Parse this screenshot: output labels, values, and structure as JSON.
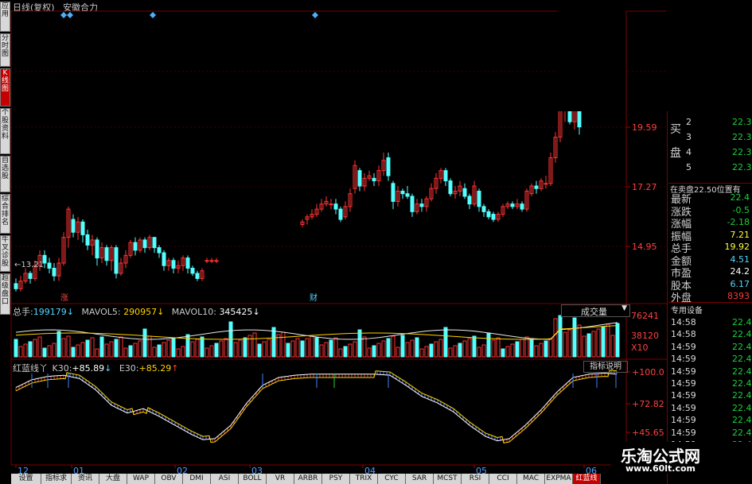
{
  "header": {
    "title": "日线(复权)",
    "indicator": "安徽合力"
  },
  "left_tabs": [
    {
      "label": "应用",
      "active": false
    },
    {
      "label": "分时图",
      "active": false
    },
    {
      "label": "K线图",
      "active": true
    },
    {
      "label": "个股资料",
      "active": false
    },
    {
      "label": "自选股",
      "active": false
    },
    {
      "label": "综合排名",
      "active": false
    },
    {
      "label": "牛叉诊股",
      "active": false
    },
    {
      "label": "超级盘口",
      "active": false
    }
  ],
  "price_axis": {
    "labels": [
      "19.59",
      "17.27",
      "14.95"
    ]
  },
  "price_annotations": {
    "low_marker": "←13.21",
    "event_rise": "涨",
    "event_finance": "财"
  },
  "volume": {
    "label_total": "总手:",
    "total": "199179",
    "mavol5_label": "MAVOL5:",
    "mavol5": "290957",
    "mavol10_label": "MAVOL10:",
    "mavol10": "345425",
    "selector": "成交量",
    "axis": [
      "76241",
      "38120",
      "X10"
    ]
  },
  "indicator_panel": {
    "name": "红蓝线丫",
    "k30_label": "K30:",
    "k30": "+85.89",
    "e30_label": "E30:",
    "e30": "+85.29",
    "help_button": "指标说明",
    "axis": [
      "+100.0",
      "+72.82",
      "+45.65"
    ]
  },
  "time_axis": [
    "12",
    "01",
    "02",
    "03",
    "04",
    "05",
    "06"
  ],
  "right_panel": {
    "buy_label_1": "买",
    "buy_label_2": "盘",
    "order_rows": [
      {
        "n": "2",
        "v": "22.3"
      },
      {
        "n": "3",
        "v": "22.3"
      },
      {
        "n": "4",
        "v": "22.3"
      },
      {
        "n": "5",
        "v": "22.3"
      }
    ],
    "notice": "在卖盘22.50位置有",
    "quote_rows": [
      {
        "k": "最新",
        "v": "22.4",
        "c": "green"
      },
      {
        "k": "涨跌",
        "v": "-0.5",
        "c": "green"
      },
      {
        "k": "涨幅",
        "v": "-2.18",
        "c": "green"
      },
      {
        "k": "振幅",
        "v": "7.21",
        "c": "yellow"
      },
      {
        "k": "总手",
        "v": "19.92",
        "c": "yellow"
      },
      {
        "k": "金额",
        "v": "4.51",
        "c": "cyan"
      },
      {
        "k": "市盈",
        "v": "24.2",
        "c": "white"
      },
      {
        "k": "股本",
        "v": "6.17",
        "c": "cyan"
      },
      {
        "k": "外盘",
        "v": "8393",
        "c": "red"
      }
    ],
    "ticks_header": "专用设备",
    "tick_rows": [
      {
        "t": "14:58",
        "v": "22.4"
      },
      {
        "t": "14:58",
        "v": "22.4"
      },
      {
        "t": "14:59",
        "v": "22.4"
      },
      {
        "t": "14:59",
        "v": "22.4"
      },
      {
        "t": "14:59",
        "v": "22.4"
      },
      {
        "t": "14:59",
        "v": "22.4"
      },
      {
        "t": "14:59",
        "v": "22.4"
      },
      {
        "t": "14:59",
        "v": "22.4"
      },
      {
        "t": "14:59",
        "v": "22.4"
      },
      {
        "t": "14:59",
        "v": "22.4"
      },
      {
        "t": "14:59",
        "v": "22.4"
      }
    ]
  },
  "bottom_tabs": [
    "设置",
    "指标求",
    "资讯",
    "大盘",
    "WAP",
    "OBV",
    "DMI",
    "ASI",
    "BOLL",
    "VR",
    "ARBR",
    "PSY",
    "TRIX",
    "CYC",
    "SAR",
    "MCST",
    "RSI",
    "CCI",
    "MAC",
    "EXPMA",
    "红蓝线"
  ],
  "watermark": {
    "text": "乐淘公式网",
    "url": "www.60lt.com"
  },
  "colors": {
    "up": "#ff3333",
    "down": "#54ffff",
    "ma_white": "#e8e8e8",
    "ma_yellow": "#ffd400",
    "grid": "#7a0000",
    "panel_bg": "#000000"
  }
}
